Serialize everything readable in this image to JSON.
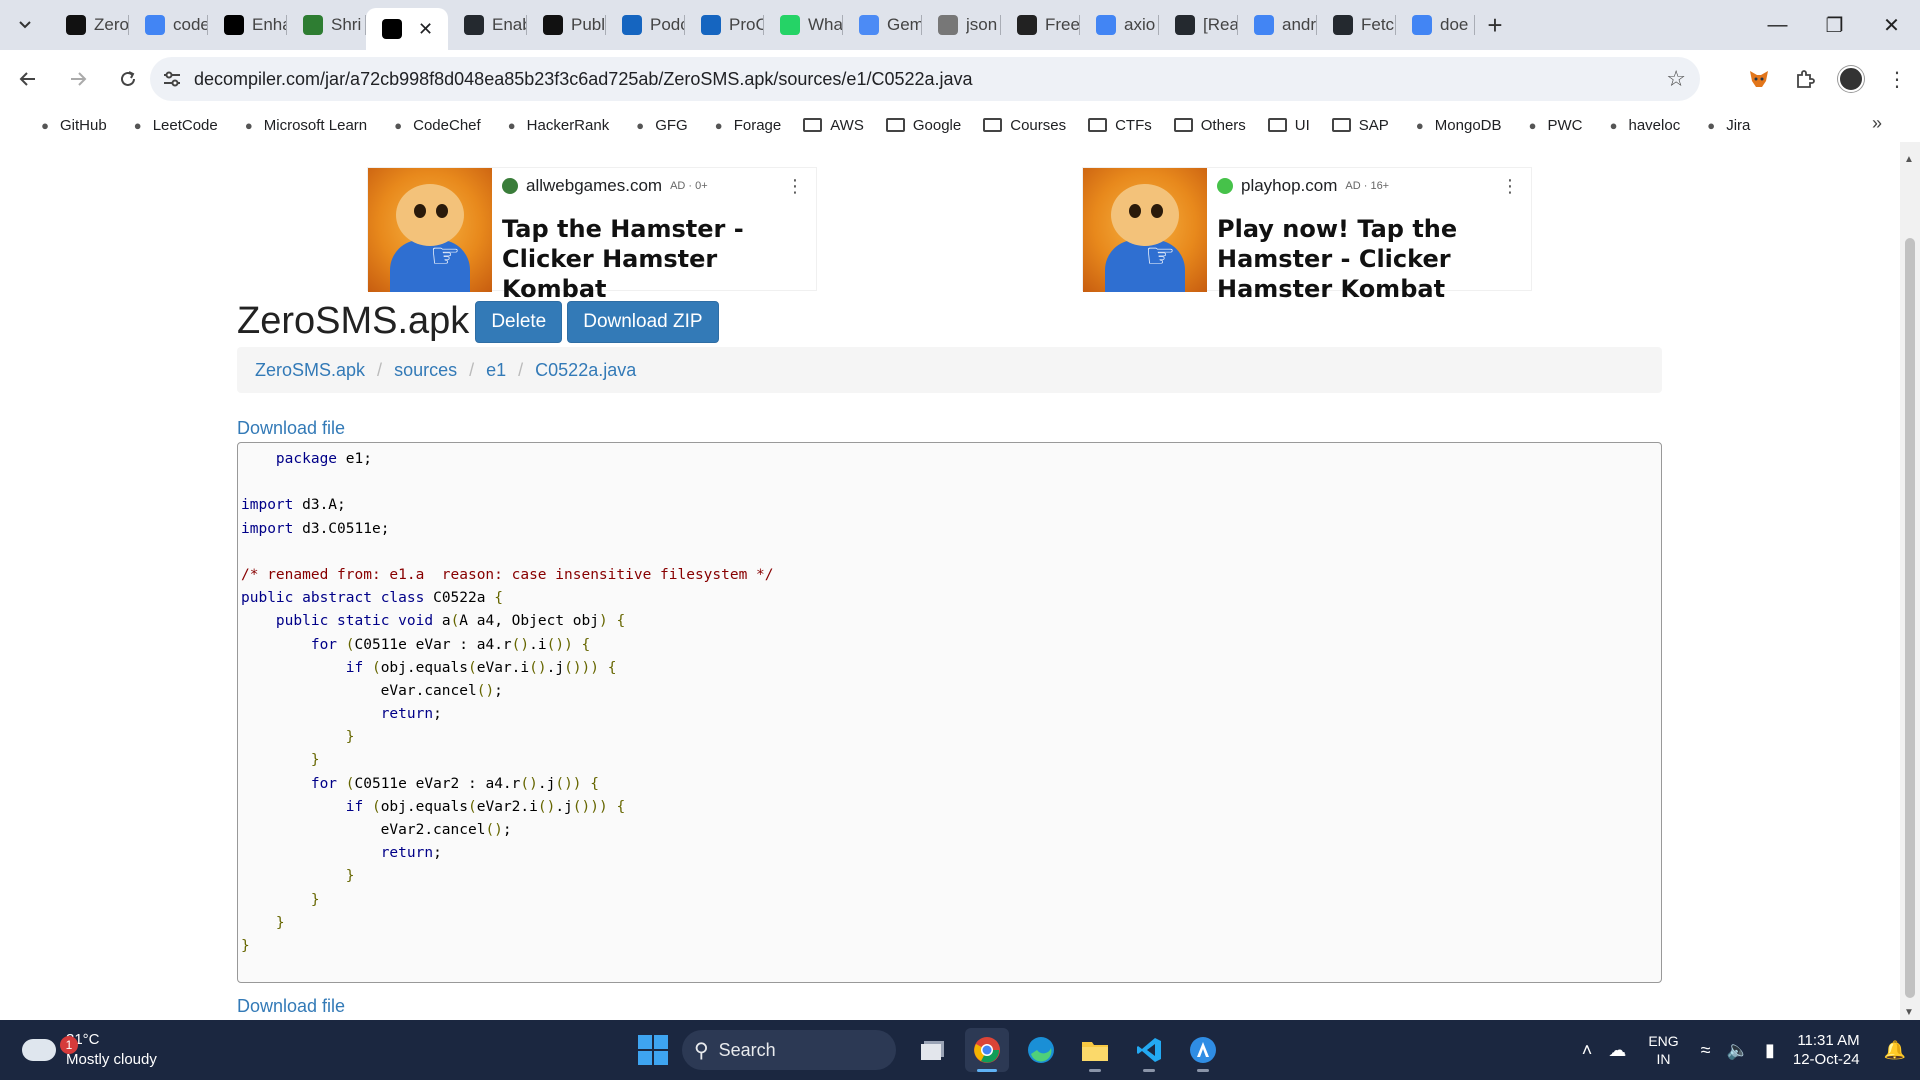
{
  "tabs": [
    {
      "title": "Zero",
      "icon": "openai-icon",
      "color": "#111111"
    },
    {
      "title": "code",
      "icon": "google-icon",
      "color": "#4285f4"
    },
    {
      "title": "Enha",
      "icon": "dev-icon",
      "color": "#000000"
    },
    {
      "title": "Shri",
      "icon": "kaggle-icon",
      "color": "#2e7d32"
    },
    {
      "title": "",
      "icon": "decompiler-icon",
      "color": "#000000",
      "active": true
    },
    {
      "title": "Enab",
      "icon": "github-icon",
      "color": "#24292f"
    },
    {
      "title": "Publ",
      "icon": "openai-icon",
      "color": "#111111"
    },
    {
      "title": "Podc",
      "icon": "podcast-icon",
      "color": "#1565c0"
    },
    {
      "title": "ProC",
      "icon": "proc-icon",
      "color": "#1565c0"
    },
    {
      "title": "Wha",
      "icon": "whatsapp-icon",
      "color": "#25d366"
    },
    {
      "title": "Gem",
      "icon": "gemini-icon",
      "color": "#4c8bf5"
    },
    {
      "title": "json",
      "icon": "globe-icon",
      "color": "#777777"
    },
    {
      "title": "Free",
      "icon": "e-icon",
      "color": "#222222"
    },
    {
      "title": "axio",
      "icon": "google-icon",
      "color": "#4285f4"
    },
    {
      "title": "[Rea",
      "icon": "github-icon",
      "color": "#24292f"
    },
    {
      "title": "andr",
      "icon": "google-icon",
      "color": "#4285f4"
    },
    {
      "title": "Fetc",
      "icon": "github-icon",
      "color": "#24292f"
    },
    {
      "title": "doe",
      "icon": "google-icon",
      "color": "#4285f4"
    }
  ],
  "address_bar": {
    "url": "decompiler.com/jar/a72cb998f8d048ea85b23f3c6ad725ab/ZeroSMS.apk/sources/e1/C0522a.java"
  },
  "bookmarks": [
    {
      "label": "GitHub",
      "icon": "github-icon"
    },
    {
      "label": "LeetCode",
      "icon": "leetcode-icon"
    },
    {
      "label": "Microsoft Learn",
      "icon": "microsoft-icon"
    },
    {
      "label": "CodeChef",
      "icon": "codechef-icon"
    },
    {
      "label": "HackerRank",
      "icon": "hackerrank-icon"
    },
    {
      "label": "GFG",
      "icon": "gfg-icon"
    },
    {
      "label": "Forage",
      "icon": "forage-icon"
    },
    {
      "label": "AWS",
      "icon": "folder-icon"
    },
    {
      "label": "Google",
      "icon": "folder-icon"
    },
    {
      "label": "Courses",
      "icon": "folder-icon"
    },
    {
      "label": "CTFs",
      "icon": "folder-icon"
    },
    {
      "label": "Others",
      "icon": "folder-icon"
    },
    {
      "label": "UI",
      "icon": "folder-icon"
    },
    {
      "label": "SAP",
      "icon": "folder-icon"
    },
    {
      "label": "MongoDB",
      "icon": "mongodb-icon"
    },
    {
      "label": "PWC",
      "icon": "pwc-icon"
    },
    {
      "label": "haveloc",
      "icon": "haveloc-icon"
    },
    {
      "label": "Jira",
      "icon": "jira-icon"
    }
  ],
  "ads": [
    {
      "site": "allwebgames.com",
      "meta": "AD · 0+",
      "title": "Tap the Hamster - Clicker Hamster Kombat",
      "dot_color": "#3a7d3a"
    },
    {
      "site": "playhop.com",
      "meta": "AD · 16+",
      "title": "Play now! Tap the Hamster - Clicker Hamster Kombat",
      "dot_color": "#46c24a"
    }
  ],
  "page": {
    "title": "ZeroSMS.apk",
    "delete_label": "Delete",
    "download_zip_label": "Download ZIP",
    "breadcrumb": [
      "ZeroSMS.apk",
      "sources",
      "e1",
      "C0522a.java"
    ],
    "download_file_label": "Download file"
  },
  "code_lines": [
    "    package e1;",
    "",
    "import d3.A;",
    "import d3.C0511e;",
    "",
    "/* renamed from: e1.a  reason: case insensitive filesystem */",
    "public abstract class C0522a {",
    "    public static void a(A a4, Object obj) {",
    "        for (C0511e eVar : a4.r().i()) {",
    "            if (obj.equals(eVar.i().j())) {",
    "                eVar.cancel();",
    "                return;",
    "            }",
    "        }",
    "        for (C0511e eVar2 : a4.r().j()) {",
    "            if (obj.equals(eVar2.i().j())) {",
    "                eVar2.cancel();",
    "                return;",
    "            }",
    "        }",
    "    }",
    "}"
  ],
  "taskbar": {
    "weather_temp": "31°C",
    "weather_desc": "Mostly cloudy",
    "weather_badge": "1",
    "search_label": "Search",
    "lang_top": "ENG",
    "lang_bottom": "IN",
    "time": "11:31 AM",
    "date": "12-Oct-24"
  },
  "colors": {
    "link": "#337ab7",
    "button": "#337ab7",
    "taskbar": "#1b2740"
  }
}
